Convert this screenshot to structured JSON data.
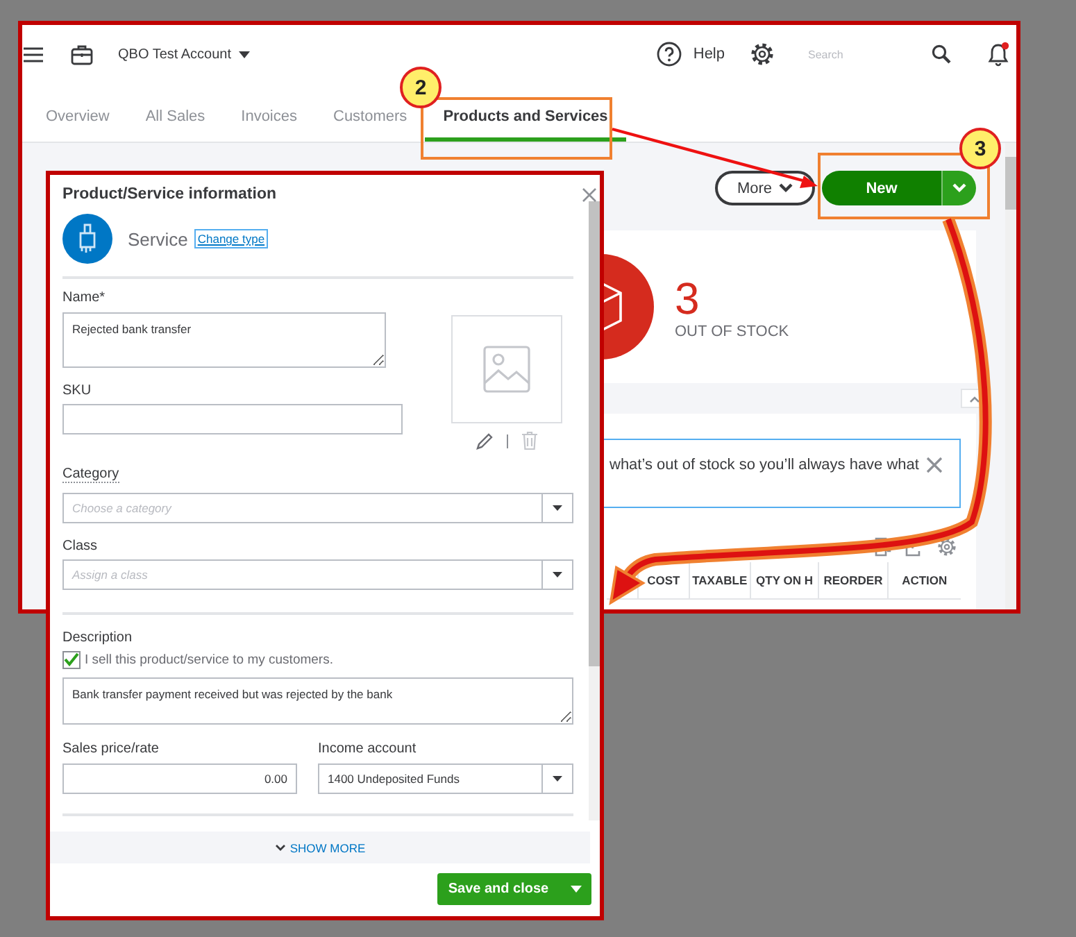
{
  "header": {
    "account": "QBO Test Account",
    "help": "Help",
    "search": {
      "placeholder": "Search"
    }
  },
  "tabs": [
    {
      "label": "Overview",
      "selected": false
    },
    {
      "label": "All Sales",
      "selected": false
    },
    {
      "label": "Invoices",
      "selected": false
    },
    {
      "label": "Customers",
      "selected": false
    },
    {
      "label": "Products and Services",
      "selected": true
    }
  ],
  "toolbar": {
    "more": "More",
    "new": "New"
  },
  "stock_card": {
    "count": "3",
    "label": "OUT OF STOCK"
  },
  "banner": {
    "text": "what’s out of stock so you’ll always have what"
  },
  "table": {
    "columns": [
      "COST",
      "TAXABLE",
      "QTY ON H",
      "REORDER",
      "ACTION"
    ]
  },
  "dialog": {
    "title": "Product/Service information",
    "type": "Service",
    "change_type": "Change type",
    "name": {
      "label": "Name*",
      "value": "Rejected bank transfer"
    },
    "sku": {
      "label": "SKU"
    },
    "category": {
      "label": "Category",
      "placeholder": "Choose a category"
    },
    "class": {
      "label": "Class",
      "placeholder": "Assign a class"
    },
    "description": {
      "label": "Description",
      "sell_label": "I sell this product/service to my customers.",
      "sell_checked": true,
      "value": "Bank transfer payment received but was rejected by the bank"
    },
    "price": {
      "label": "Sales price/rate",
      "value": "0.00"
    },
    "income_account": {
      "label": "Income account",
      "value": "1400 Undeposited Funds"
    },
    "show_more": "SHOW MORE",
    "save": "Save and close"
  },
  "annotations": [
    {
      "kind": "step",
      "label": "2"
    },
    {
      "kind": "step",
      "label": "3"
    }
  ]
}
